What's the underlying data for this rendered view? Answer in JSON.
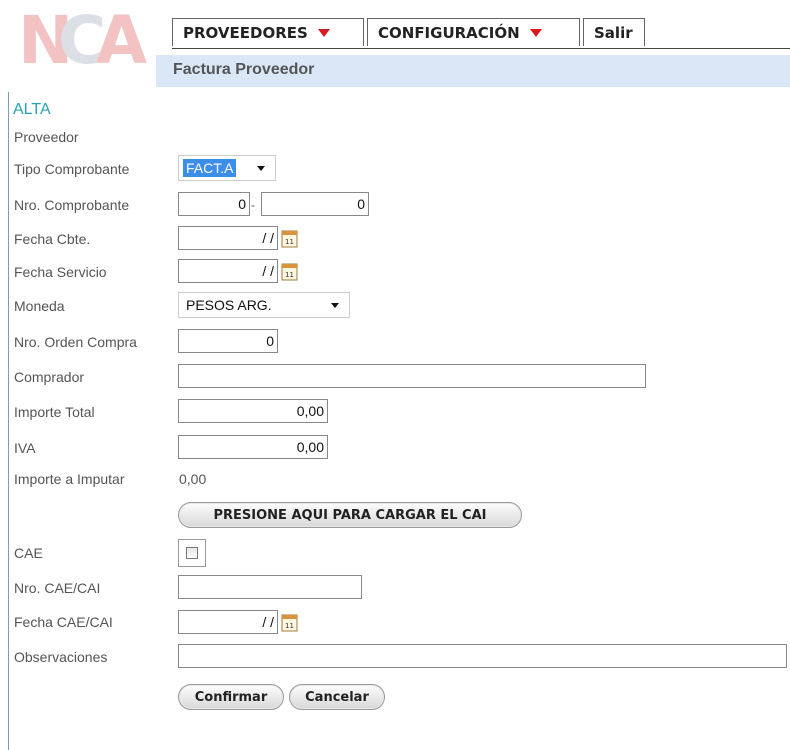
{
  "logo": {
    "text": "NCA"
  },
  "menu": {
    "proveedores": "PROVEEDORES",
    "configuracion": "CONFIGURACIÓN",
    "salir": "Salir"
  },
  "page_title": "Factura Proveedor",
  "section": "ALTA",
  "colors": {
    "accent": "#2aa1b3",
    "subbar": "#d9e7f7",
    "menu_arrow": "#d71920",
    "logo": "#f4c6c6"
  },
  "form": {
    "proveedor_label": "Proveedor",
    "tipo_comprobante_label": "Tipo Comprobante",
    "tipo_comprobante_value": "FACT.A",
    "nro_comprobante_label": "Nro. Comprobante",
    "nro_comprobante_punto": "0",
    "nro_comprobante_separator": "-",
    "nro_comprobante_numero": "0",
    "fecha_cbte_label": "Fecha Cbte.",
    "fecha_cbte_value": "/ /",
    "fecha_servicio_label": "Fecha Servicio",
    "fecha_servicio_value": "/ /",
    "moneda_label": "Moneda",
    "moneda_value": "PESOS ARG.",
    "nro_orden_compra_label": "Nro. Orden Compra",
    "nro_orden_compra_value": "0",
    "comprador_label": "Comprador",
    "comprador_value": "",
    "importe_total_label": "Importe Total",
    "importe_total_value": "0,00",
    "iva_label": "IVA",
    "iva_value": "0,00",
    "importe_imputar_label": "Importe a Imputar",
    "importe_imputar_value": "0,00",
    "cargar_cai_button": "PRESIONE AQUI PARA CARGAR EL CAI",
    "cae_label": "CAE",
    "nro_cae_label": "Nro. CAE/CAI",
    "nro_cae_value": "",
    "fecha_cae_label": "Fecha CAE/CAI",
    "fecha_cae_value": "/ /",
    "observaciones_label": "Observaciones",
    "observaciones_value": "",
    "calendar_day": "11"
  },
  "actions": {
    "confirmar": "Confirmar",
    "cancelar": "Cancelar"
  }
}
